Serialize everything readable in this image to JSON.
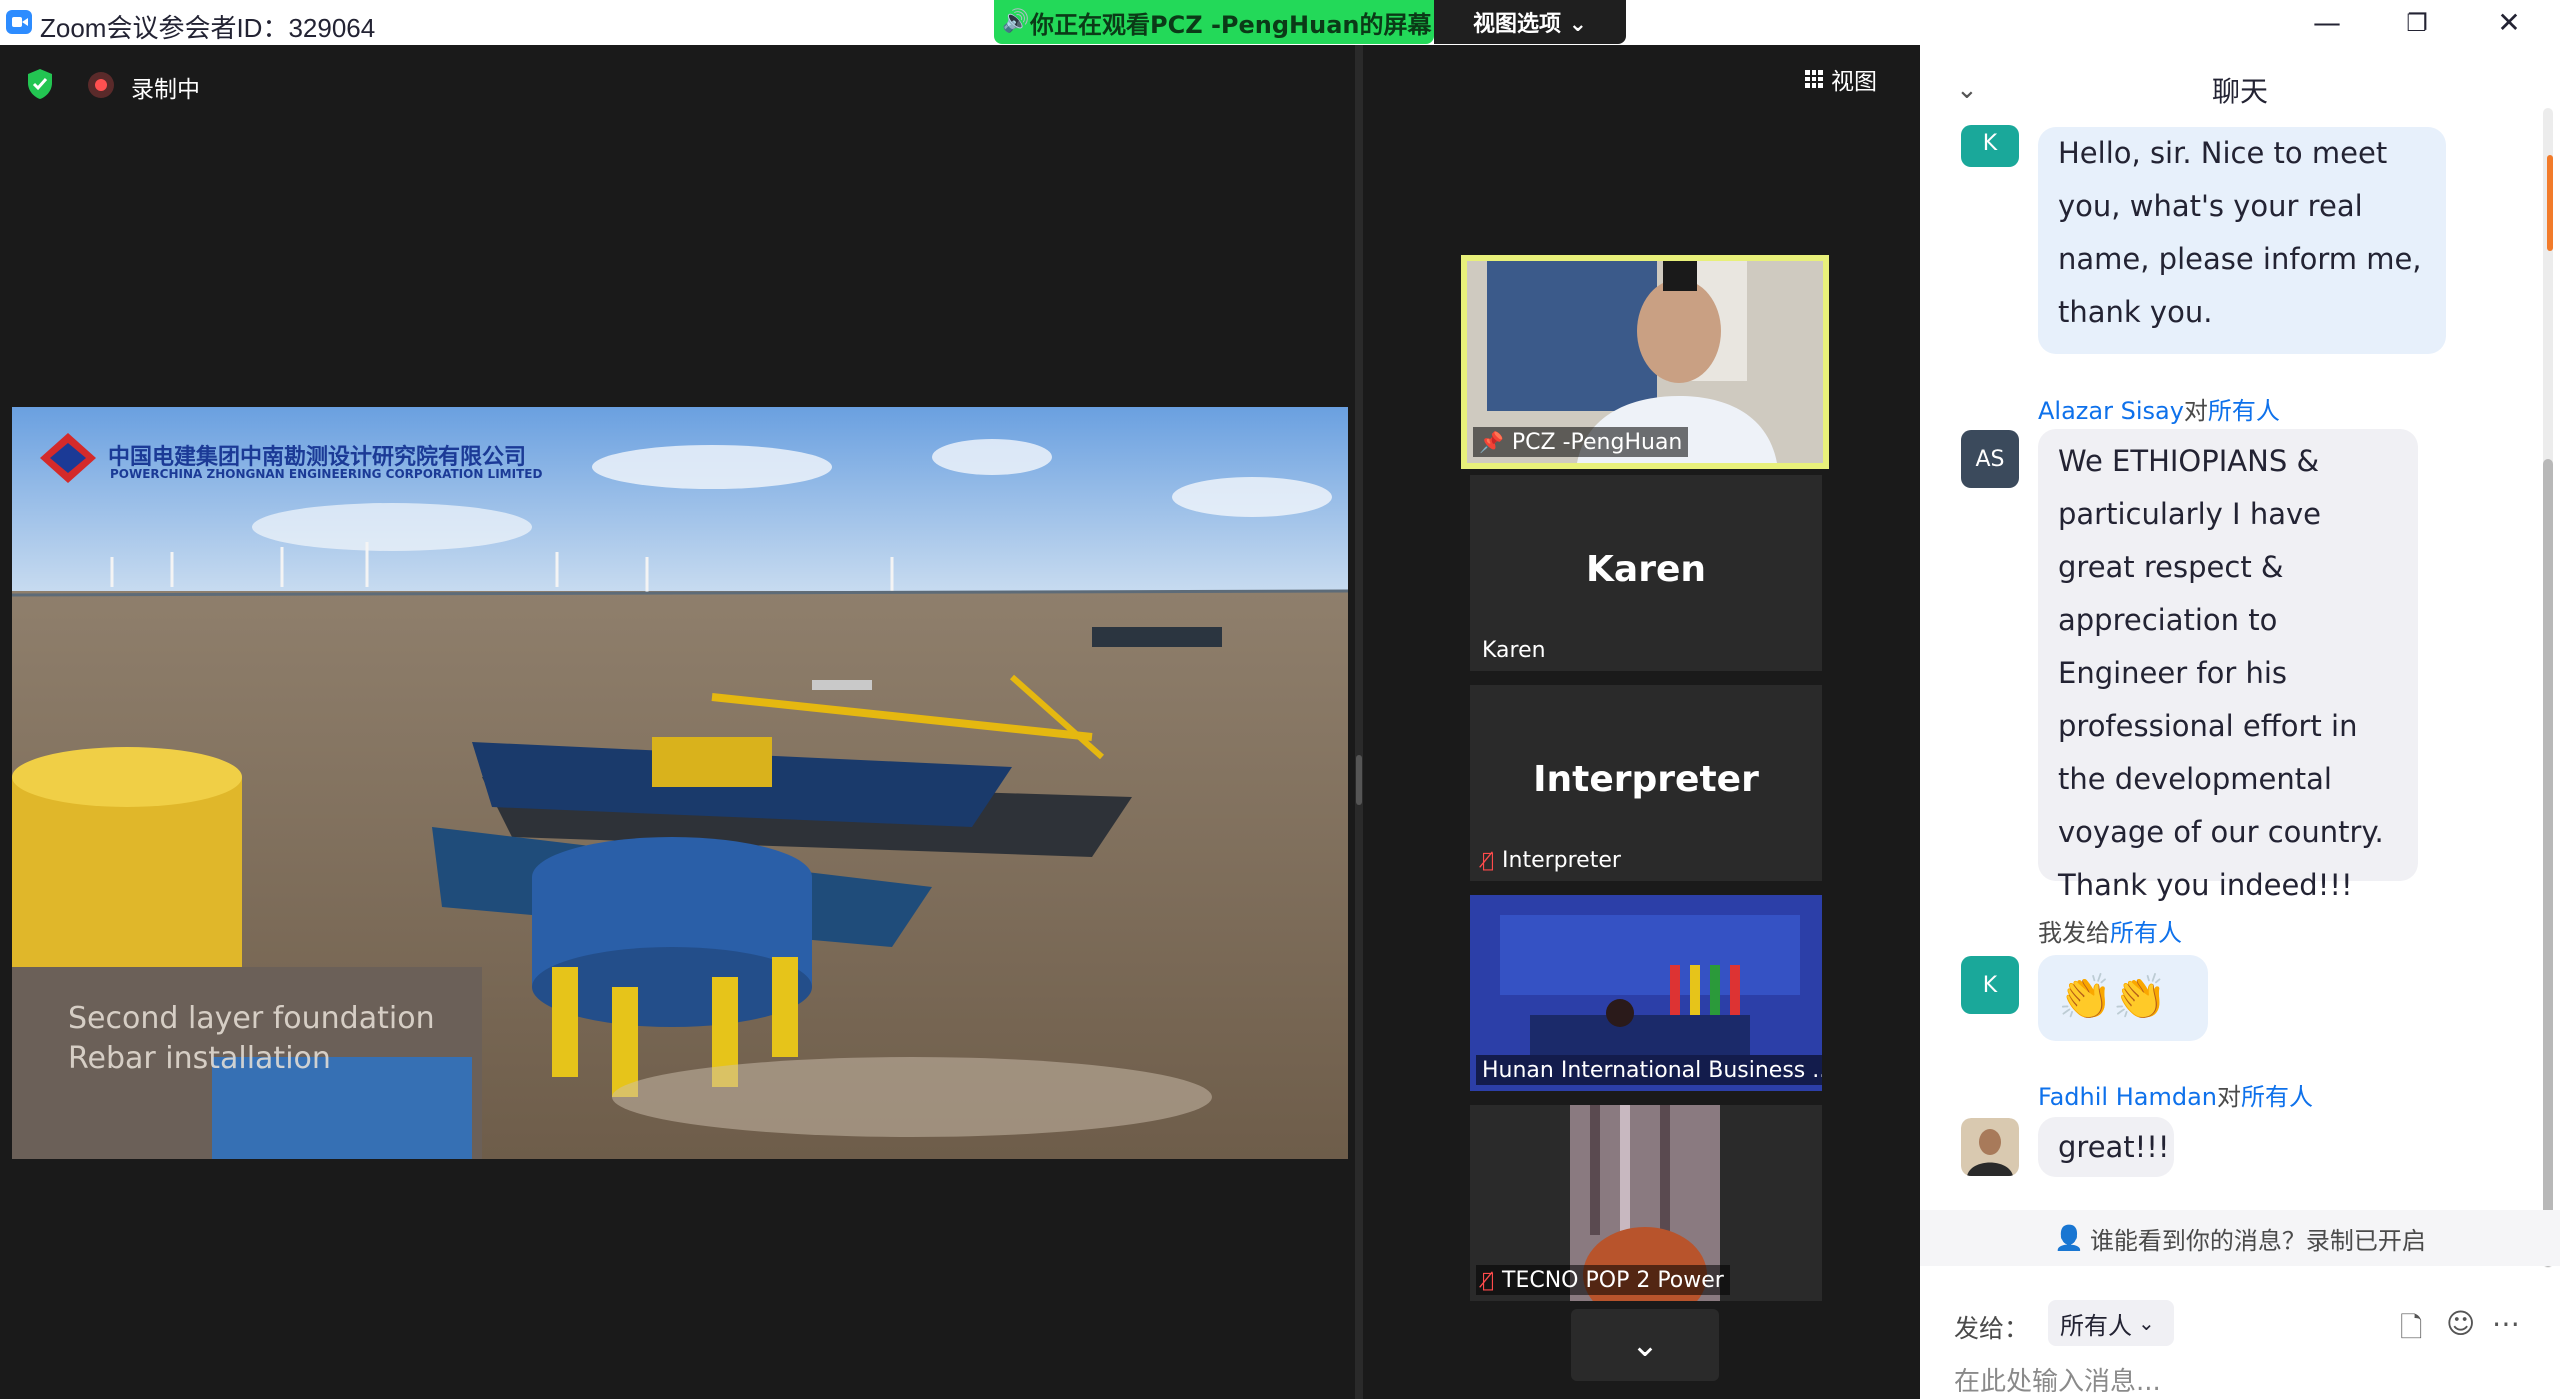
{
  "titlebar": {
    "title": "Zoom会议参会者ID：329064",
    "minimize": "—",
    "restore": "❐",
    "close": "✕"
  },
  "share_banner": {
    "text": "你正在观看PCZ  -PengHuan的屏幕",
    "view_options": "视图选项 ⌄"
  },
  "main": {
    "recording": "录制中",
    "view_label": "视图",
    "shared": {
      "company_cn": "中国电建集团中南勘测设计研究院有限公司",
      "company_en": "POWERCHINA ZHONGNAN ENGINEERING CORPORATION LIMITED",
      "caption_line1": "Second layer foundation",
      "caption_line2": "Rebar installation"
    }
  },
  "participants": [
    {
      "name": "PCZ -PengHuan",
      "big_name": "",
      "pinned": true,
      "muted": false,
      "video": true
    },
    {
      "name": "Karen",
      "big_name": "Karen",
      "pinned": false,
      "muted": false,
      "video": false
    },
    {
      "name": "Interpreter",
      "big_name": "Interpreter",
      "pinned": false,
      "muted": true,
      "video": false
    },
    {
      "name": "Hunan International Business ...",
      "big_name": "",
      "pinned": false,
      "muted": false,
      "video": true
    },
    {
      "name": "TECNO POP 2 Power",
      "big_name": "",
      "pinned": false,
      "muted": true,
      "video": true
    }
  ],
  "chat": {
    "title": "聊天",
    "messages": [
      {
        "avatar": "K",
        "avatar_color": "#1aa89a",
        "sender": "",
        "to": "",
        "text": "Hello, sir. Nice to meet you, what's your real name, please inform me, thank you."
      },
      {
        "avatar": "AS",
        "avatar_color": "#3b4a5c",
        "sender": "Alazar Sisay",
        "to_prefix": "对",
        "to": "所有人",
        "text": "We ETHIOPIANS & particularly I have great respect & appreciation to Engineer for his professional effort in the developmental voyage of our country. Thank you indeed!!!"
      },
      {
        "avatar": "K",
        "avatar_color": "#1aa89a",
        "sender": "我发给",
        "to_prefix": "",
        "to": "所有人",
        "text": "👏👏"
      },
      {
        "avatar": "",
        "avatar_color": "#7a6a5a",
        "sender": "Fadhil Hamdan",
        "to_prefix": "对",
        "to": "所有人",
        "text": "great!!!"
      }
    ],
    "privacy_notice": "谁能看到你的消息？录制已开启",
    "send_to_label": "发给：",
    "send_to_value": "所有人",
    "input_placeholder": "在此处输入消息..."
  },
  "colors": {
    "banner": "#23d959",
    "active_speaker": "#e8f07a",
    "link": "#0e71eb",
    "bubble_blue": "#e7f0fb"
  }
}
